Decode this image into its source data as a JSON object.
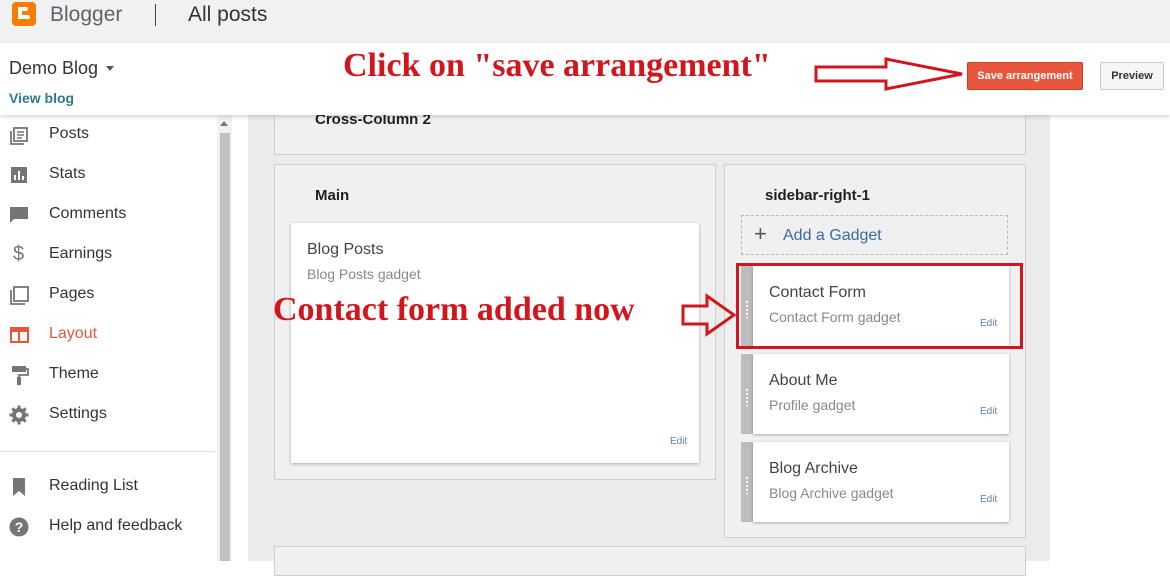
{
  "topbar": {
    "brand": "Blogger",
    "page_title": "All posts"
  },
  "header": {
    "blog_name": "Demo Blog",
    "view_blog": "View blog",
    "save_button": "Save arrangement",
    "preview_button": "Preview"
  },
  "annotations": {
    "top": "Click on \"save arrangement\"",
    "middle": "Contact form added now"
  },
  "sidebar": {
    "items": [
      {
        "label": "Posts",
        "icon": "posts-icon"
      },
      {
        "label": "Stats",
        "icon": "stats-icon"
      },
      {
        "label": "Comments",
        "icon": "comments-icon"
      },
      {
        "label": "Earnings",
        "icon": "dollar-icon"
      },
      {
        "label": "Pages",
        "icon": "pages-icon"
      },
      {
        "label": "Layout",
        "icon": "layout-icon",
        "active": true
      },
      {
        "label": "Theme",
        "icon": "paint-roller-icon"
      },
      {
        "label": "Settings",
        "icon": "gear-icon"
      },
      {
        "label": "Reading List",
        "icon": "bookmark-icon"
      },
      {
        "label": "Help and feedback",
        "icon": "help-icon"
      }
    ]
  },
  "layout": {
    "cross_column_title": "Cross-Column 2",
    "main": {
      "title": "Main",
      "gadget": {
        "title": "Blog Posts",
        "subtitle": "Blog Posts gadget",
        "edit": "Edit"
      }
    },
    "sidebar_right": {
      "title": "sidebar-right-1",
      "add_gadget": "Add a Gadget",
      "gadgets": [
        {
          "title": "Contact Form",
          "subtitle": "Contact Form gadget",
          "edit": "Edit"
        },
        {
          "title": "About Me",
          "subtitle": "Profile gadget",
          "edit": "Edit"
        },
        {
          "title": "Blog Archive",
          "subtitle": "Blog Archive gadget",
          "edit": "Edit"
        }
      ]
    }
  },
  "colors": {
    "accent": "#e8573d",
    "annotation": "#d1161d",
    "brand": "#f57d00"
  }
}
